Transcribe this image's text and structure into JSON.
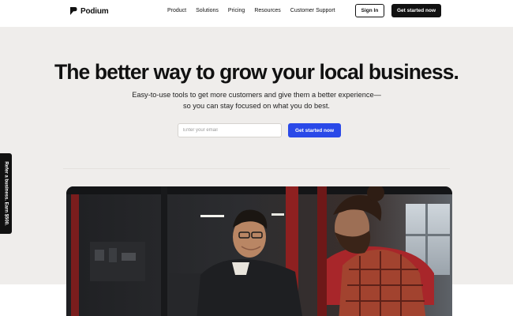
{
  "header": {
    "brand": "Podium",
    "nav": [
      "Product",
      "Solutions",
      "Pricing",
      "Resources",
      "Customer Support"
    ],
    "sign_in": "Sign In",
    "cta": "Get started now"
  },
  "hero": {
    "title": "The better way to grow your local business.",
    "subtitle_line1": "Easy-to-use tools to get more customers and give them a better experience—",
    "subtitle_line2": "so you can stay focused on what you do best.",
    "email_placeholder": "Enter your email",
    "cta": "Get started now"
  },
  "side_tab": {
    "label": "Refer a business. Earn $500."
  },
  "colors": {
    "accent": "#2a49e8",
    "dark": "#111111",
    "page_bg": "#efedeb"
  },
  "icons": {
    "logo": "podium-logo-icon"
  }
}
